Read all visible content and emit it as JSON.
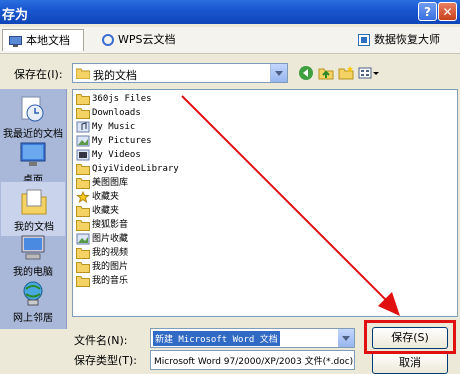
{
  "window": {
    "title": "存为",
    "help_label": "?",
    "close_label": "✕"
  },
  "tabs": [
    {
      "label": "本地文档",
      "icon": "computer-icon"
    },
    {
      "label": "WPS云文档",
      "icon": "cloud-icon"
    },
    {
      "label": "数据恢复大师",
      "icon": "recovery-icon"
    }
  ],
  "location": {
    "label": "保存在(I):",
    "value": "我的文档"
  },
  "places": [
    {
      "label": "我最近的文档",
      "icon": "recent-docs-icon"
    },
    {
      "label": "桌面",
      "icon": "desktop-icon"
    },
    {
      "label": "我的文档",
      "icon": "my-documents-icon"
    },
    {
      "label": "我的电脑",
      "icon": "my-computer-icon"
    },
    {
      "label": "网上邻居",
      "icon": "network-icon"
    }
  ],
  "files": [
    {
      "name": "360js Files",
      "icon": "folder-icon"
    },
    {
      "name": "Downloads",
      "icon": "folder-icon"
    },
    {
      "name": "My Music",
      "icon": "music-folder-icon"
    },
    {
      "name": "My Pictures",
      "icon": "pictures-folder-icon"
    },
    {
      "name": "My Videos",
      "icon": "videos-folder-icon"
    },
    {
      "name": "QiyiVideoLibrary",
      "icon": "folder-icon"
    },
    {
      "name": "美图图库",
      "icon": "folder-icon"
    },
    {
      "name": "收藏夹",
      "icon": "favorites-folder-icon"
    },
    {
      "name": "收藏夹",
      "icon": "folder-icon"
    },
    {
      "name": "搜狐影音",
      "icon": "folder-icon"
    },
    {
      "name": "图片收藏",
      "icon": "pictures-folder-icon"
    },
    {
      "name": "我的视频",
      "icon": "folder-icon"
    },
    {
      "name": "我的图片",
      "icon": "folder-icon"
    },
    {
      "name": "我的音乐",
      "icon": "folder-icon"
    }
  ],
  "filename": {
    "label": "文件名(N):",
    "value": "新建 Microsoft Word 文档"
  },
  "filetype": {
    "label": "保存类型(T):",
    "value": "Microsoft Word 97/2000/XP/2003 文件(*.doc)"
  },
  "buttons": {
    "save": "保存(S)",
    "cancel": "取消"
  },
  "colors": {
    "titlebar": "#0f45b8",
    "annotation": "#e01010",
    "selection": "#316ac5"
  }
}
